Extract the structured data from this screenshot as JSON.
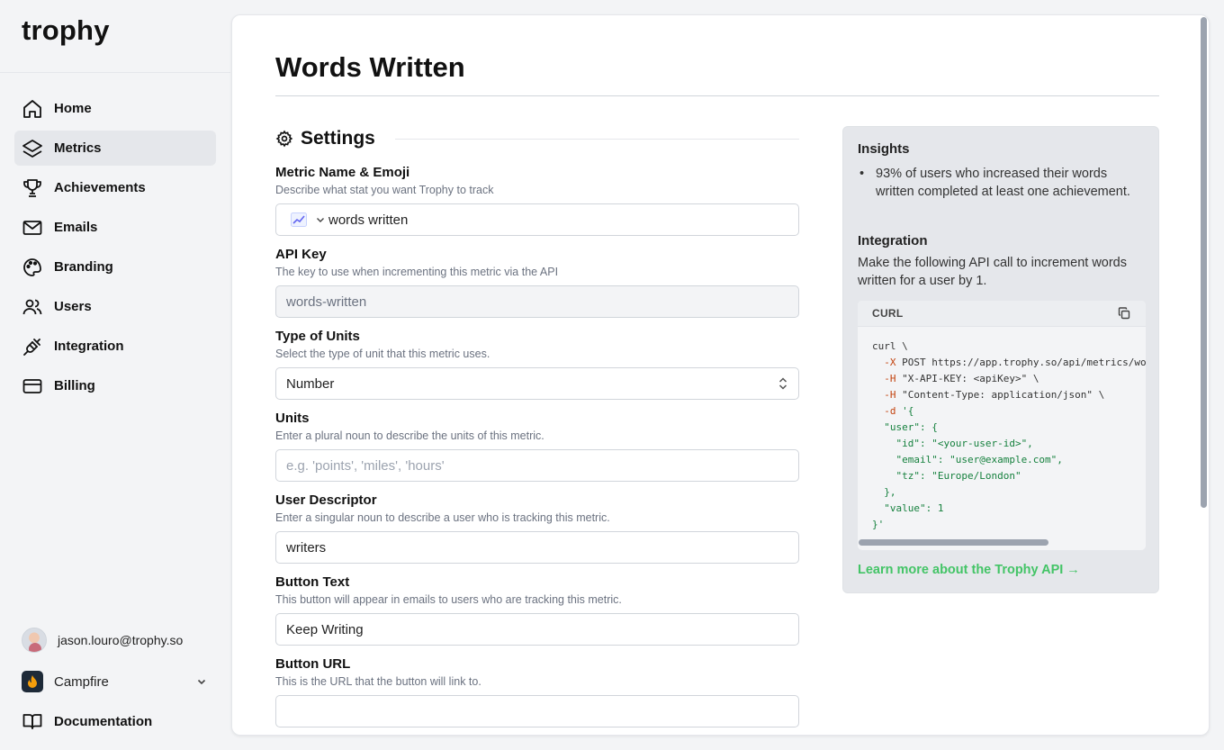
{
  "app": {
    "logo": "trophy"
  },
  "sidebar": {
    "items": [
      {
        "label": "Home",
        "icon": "home-icon",
        "active": false
      },
      {
        "label": "Metrics",
        "icon": "layers-icon",
        "active": true
      },
      {
        "label": "Achievements",
        "icon": "trophy-icon",
        "active": false
      },
      {
        "label": "Emails",
        "icon": "mail-icon",
        "active": false
      },
      {
        "label": "Branding",
        "icon": "palette-icon",
        "active": false
      },
      {
        "label": "Users",
        "icon": "users-icon",
        "active": false
      },
      {
        "label": "Integration",
        "icon": "plug-icon",
        "active": false
      },
      {
        "label": "Billing",
        "icon": "credit-card-icon",
        "active": false
      }
    ],
    "user_email": "jason.louro@trophy.so",
    "org_name": "Campfire",
    "documentation_label": "Documentation"
  },
  "page": {
    "title": "Words Written",
    "settings_label": "Settings"
  },
  "form": {
    "metric_name": {
      "label": "Metric Name & Emoji",
      "description": "Describe what stat you want Trophy to track",
      "emoji": "📈",
      "value": "words written"
    },
    "api_key": {
      "label": "API Key",
      "description": "The key to use when incrementing this metric via the API",
      "value": "words-written"
    },
    "unit_type": {
      "label": "Type of Units",
      "description": "Select the type of unit that this metric uses.",
      "value": "Number"
    },
    "units": {
      "label": "Units",
      "description": "Enter a plural noun to describe the units of this metric.",
      "placeholder": "e.g. 'points', 'miles', 'hours'"
    },
    "user_descriptor": {
      "label": "User Descriptor",
      "description": "Enter a singular noun to describe a user who is tracking this metric.",
      "value": "writers"
    },
    "button_text": {
      "label": "Button Text",
      "description": "This button will appear in emails to users who are tracking this metric.",
      "value": "Keep Writing"
    },
    "button_url": {
      "label": "Button URL",
      "description": "This is the URL that the button will link to."
    }
  },
  "panel": {
    "insights_heading": "Insights",
    "insights": [
      "93% of users who increased their words written completed at least one achievement."
    ],
    "integration_heading": "Integration",
    "integration_text": "Make the following API call to increment words written for a user by 1.",
    "code_language": "CURL",
    "code_lines": [
      [
        {
          "t": "curl \\",
          "c": ""
        }
      ],
      [
        {
          "t": "  -X ",
          "c": "kw"
        },
        {
          "t": "POST https://app.trophy.so/api/metrics/words-written/event \\",
          "c": ""
        }
      ],
      [
        {
          "t": "  -H ",
          "c": "kw"
        },
        {
          "t": "\"X-API-KEY: <apiKey>\" \\",
          "c": ""
        }
      ],
      [
        {
          "t": "  -H ",
          "c": "kw"
        },
        {
          "t": "\"Content-Type: application/json\" \\",
          "c": ""
        }
      ],
      [
        {
          "t": "  -d ",
          "c": "kw"
        },
        {
          "t": "'{",
          "c": "str"
        }
      ],
      [
        {
          "t": "  \"user\": {",
          "c": "str"
        }
      ],
      [
        {
          "t": "    \"id\": \"<your-user-id>\",",
          "c": "str"
        }
      ],
      [
        {
          "t": "    \"email\": \"user@example.com\",",
          "c": "str"
        }
      ],
      [
        {
          "t": "    \"tz\": \"Europe/London\"",
          "c": "str"
        }
      ],
      [
        {
          "t": "  },",
          "c": "str"
        }
      ],
      [
        {
          "t": "  \"value\": 1",
          "c": "str"
        }
      ],
      [
        {
          "t": "}'",
          "c": "str"
        }
      ]
    ],
    "learn_more": "Learn more about the Trophy API →"
  },
  "colors": {
    "accent_green": "#43c466",
    "active_nav_bg": "#e5e7eb"
  }
}
